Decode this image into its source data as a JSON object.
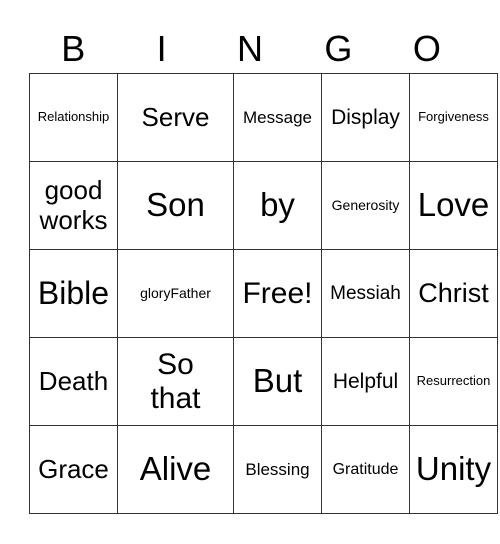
{
  "header": [
    "B",
    "I",
    "N",
    "G",
    "O"
  ],
  "cells": [
    [
      "Relationship",
      "Serve",
      "Message",
      "Display",
      "Forgiveness"
    ],
    [
      "good works",
      "Son",
      "by",
      "Generosity",
      "Love"
    ],
    [
      "Bible",
      "gloryFather",
      "Free!",
      "Messiah",
      "Christ"
    ],
    [
      "Death",
      "So that",
      "But",
      "Helpful",
      "Resurrection"
    ],
    [
      "Grace",
      "Alive",
      "Blessing",
      "Gratitude",
      "Unity"
    ]
  ]
}
